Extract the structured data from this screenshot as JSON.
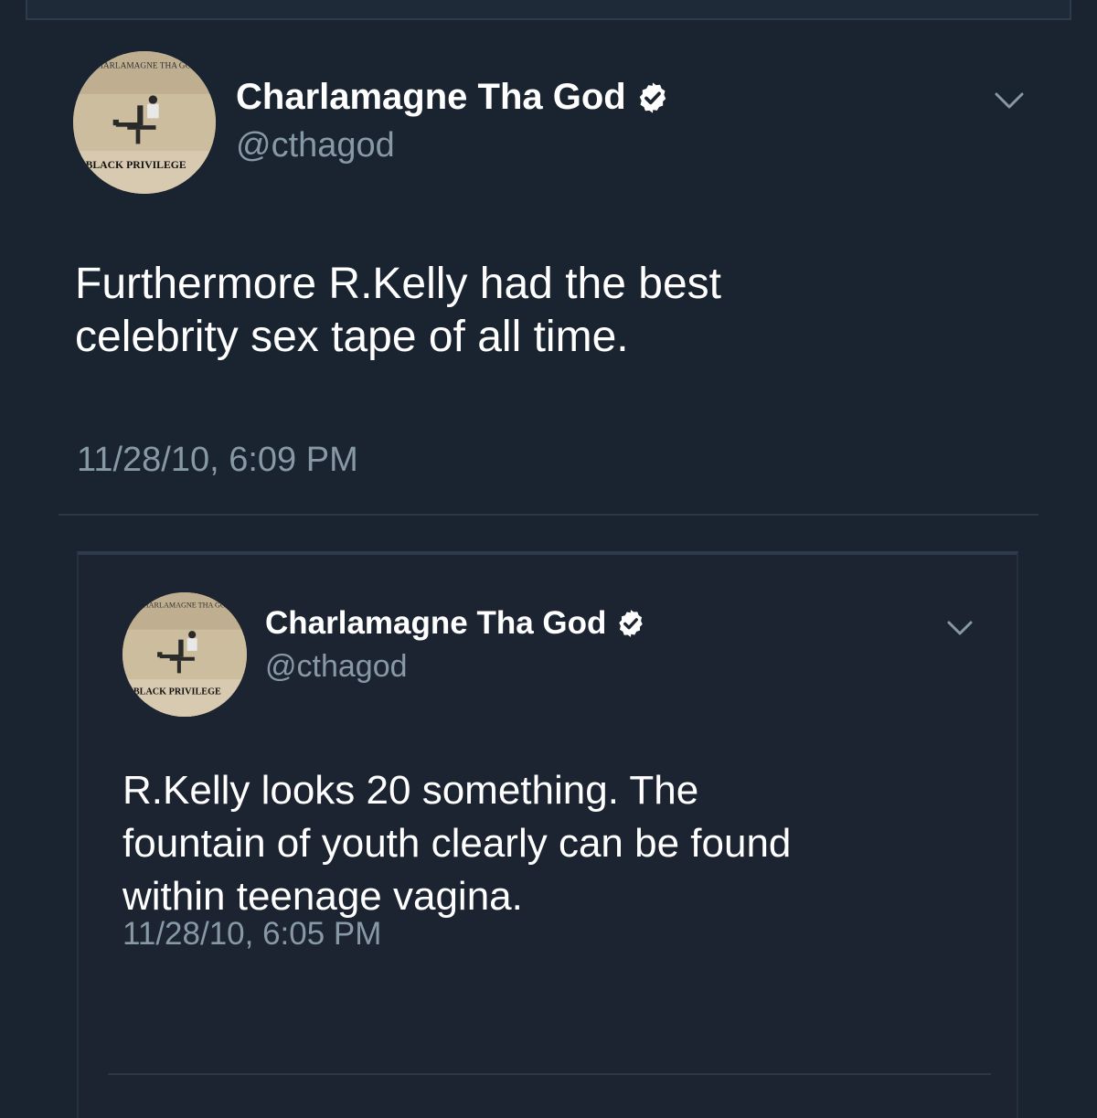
{
  "tweets": [
    {
      "avatar_label": "CHARLAMAGNE THA GOD",
      "avatar_title": "BLACK PRIVILEGE",
      "name": "Charlamagne Tha God",
      "handle": "@cthagod",
      "text": "Furthermore R.Kelly had the best\ncelebrity sex tape of all time.",
      "timestamp": "11/28/10, 6:09 PM"
    },
    {
      "avatar_label": "CHARLAMAGNE THA GOD",
      "avatar_title": "BLACK PRIVILEGE",
      "name": "Charlamagne Tha God",
      "handle": "@cthagod",
      "text": "R.Kelly looks 20 something. The\nfountain of youth clearly can be found\nwithin teenage vagina.",
      "timestamp": "11/28/10, 6:05 PM"
    }
  ],
  "icons": {
    "verified": "verified-badge-icon",
    "menu": "chevron-down-icon"
  },
  "colors": {
    "background": "#1a2330",
    "text": "#ffffff",
    "secondary": "#8899a6",
    "divider": "#2b3646"
  }
}
